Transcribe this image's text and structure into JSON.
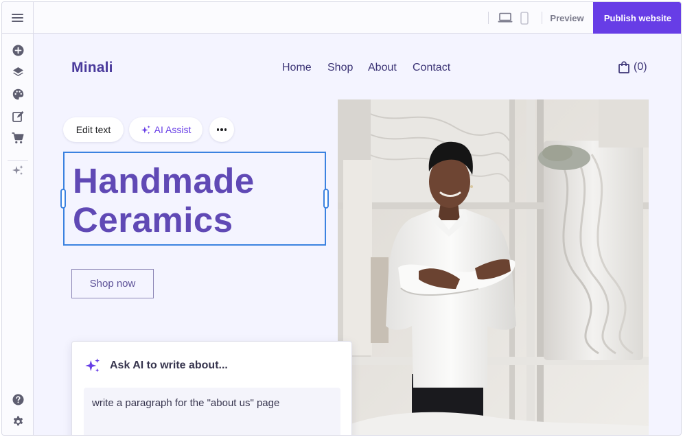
{
  "toolbar": {
    "preview_label": "Preview",
    "publish_label": "Publish website",
    "accent_color": "#673de6"
  },
  "sidebar": {
    "items": [
      {
        "icon": "plus-circle-icon"
      },
      {
        "icon": "layers-icon"
      },
      {
        "icon": "palette-icon"
      },
      {
        "icon": "edit-page-icon"
      },
      {
        "icon": "cart-icon"
      },
      {
        "icon": "sparkles-icon"
      }
    ],
    "bottom_items": [
      {
        "icon": "help-icon"
      },
      {
        "icon": "gear-icon"
      }
    ]
  },
  "site": {
    "logo": "Minali",
    "nav": [
      "Home",
      "Shop",
      "About",
      "Contact"
    ],
    "cart_count": "(0)",
    "heading_line1": "Handmade",
    "heading_line2": "Ceramics",
    "cta_label": "Shop now",
    "hero_image": "ceramic-artist-photo"
  },
  "edit_toolbar": {
    "edit_text_label": "Edit text",
    "ai_assist_label": "AI Assist"
  },
  "ai_prompt": {
    "title": "Ask AI to write about...",
    "value": "write a paragraph for the \"about us\" page"
  }
}
